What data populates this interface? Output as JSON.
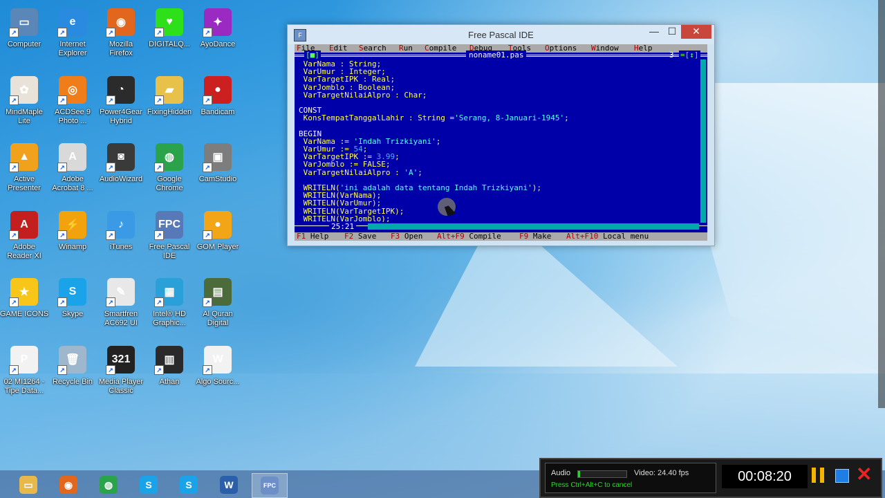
{
  "desktop_icons": [
    {
      "label": "Computer",
      "icon": "computer-icon",
      "color": "#5a86b8",
      "glyph": "▭"
    },
    {
      "label": "Internet\nExplorer",
      "icon": "ie-icon",
      "color": "#2a8ae0",
      "glyph": "e"
    },
    {
      "label": "Mozilla\nFirefox",
      "icon": "firefox-icon",
      "color": "#e2661c",
      "glyph": "◉"
    },
    {
      "label": "DIGITALQ...",
      "icon": "heart-icon",
      "color": "#2ee01a",
      "glyph": "♥"
    },
    {
      "label": "AyoDance",
      "icon": "ayodance-icon",
      "color": "#9b2ac2",
      "glyph": "✦"
    },
    {
      "label": "MindMaple\nLite",
      "icon": "mindmaple-icon",
      "color": "#e8e2d8",
      "glyph": "✿"
    },
    {
      "label": "ACDSee 9\nPhoto ...",
      "icon": "camera-icon",
      "color": "#ee7d1a",
      "glyph": "◎"
    },
    {
      "label": "Power4Gear\nHybrid",
      "icon": "gauge-icon",
      "color": "#2b2b2b",
      "glyph": "◔"
    },
    {
      "label": "FixingHidden",
      "icon": "folder-icon",
      "color": "#e8c14a",
      "glyph": "▰"
    },
    {
      "label": "Bandicam",
      "icon": "bandicam-icon",
      "color": "#cc1f1f",
      "glyph": "●"
    },
    {
      "label": "Active\nPresenter",
      "icon": "activepresenter-icon",
      "color": "#f0a21c",
      "glyph": "▲"
    },
    {
      "label": "Adobe\nAcrobat 8 ...",
      "icon": "acrobat-icon",
      "color": "#d9d9d9",
      "glyph": "A"
    },
    {
      "label": "AudioWizard",
      "icon": "speaker-icon",
      "color": "#3a3a3a",
      "glyph": "◙"
    },
    {
      "label": "Google\nChrome",
      "icon": "chrome-icon",
      "color": "#2aa34a",
      "glyph": "◍"
    },
    {
      "label": "CamStudio",
      "icon": "camstudio-icon",
      "color": "#7d7d7d",
      "glyph": "▣"
    },
    {
      "label": "Adobe\nReader XI",
      "icon": "adobe-reader-icon",
      "color": "#c41f1f",
      "glyph": "A"
    },
    {
      "label": "Winamp",
      "icon": "winamp-icon",
      "color": "#f2a20c",
      "glyph": "⚡"
    },
    {
      "label": "iTunes",
      "icon": "itunes-icon",
      "color": "#3a9ae6",
      "glyph": "♪"
    },
    {
      "label": "Free Pascal\nIDE",
      "icon": "freepascal-icon",
      "color": "#5779b8",
      "glyph": "FPC"
    },
    {
      "label": "GOM Player",
      "icon": "gomplayer-icon",
      "color": "#f2a516",
      "glyph": "●"
    },
    {
      "label": "GAME ICONS",
      "icon": "star-icon",
      "color": "#f7c618",
      "glyph": "★"
    },
    {
      "label": "Skype",
      "icon": "skype-icon",
      "color": "#1aa3e8",
      "glyph": "S"
    },
    {
      "label": "Smartfren\nAC692 UI",
      "icon": "smartfren-icon",
      "color": "#e8e8e8",
      "glyph": "✎"
    },
    {
      "label": "Intel® HD\nGraphic...",
      "icon": "intel-icon",
      "color": "#2aa0d8",
      "glyph": "▦"
    },
    {
      "label": "Al Quran\nDigital",
      "icon": "quran-icon",
      "color": "#4b6b3a",
      "glyph": "▤"
    },
    {
      "label": "02 MI1264 -\nTipe Data...",
      "icon": "powerpoint-file-icon",
      "color": "#f2f2f2",
      "glyph": "P"
    },
    {
      "label": "Recycle Bin",
      "icon": "recycle-bin-icon",
      "color": "#9fb7cc",
      "glyph": "🗑"
    },
    {
      "label": "Media Player\nClassic",
      "icon": "mediaplayer-icon",
      "color": "#222",
      "glyph": "321"
    },
    {
      "label": "Athan",
      "icon": "athan-icon",
      "color": "#2a2a2a",
      "glyph": "▥"
    },
    {
      "label": "Algo Sourc...",
      "icon": "word-file-icon",
      "color": "#f2f2f2",
      "glyph": "W"
    }
  ],
  "window": {
    "title": "Free Pascal IDE",
    "min_glyph": "—",
    "max_glyph": "☐",
    "close_glyph": "✕",
    "menu": [
      "File",
      "Edit",
      "Search",
      "Run",
      "Compile",
      "Debug",
      "Tools",
      "Options",
      "Window",
      "Help"
    ],
    "editor": {
      "filename": "noname01.pas",
      "window_number": "3",
      "close_btn": "[■]",
      "zoom_btn": "=[↕]",
      "cursor_position": "25:21",
      "code_lines": [
        " VarNama : String;",
        " VarUmur : Integer;",
        " VarTargetIPK : Real;",
        " VarJomblo : Boolean;",
        " VarTargetNilaiAlpro : Char;",
        "",
        "CONST",
        " KonsTempatTanggalLahir : String ='Serang, 8-Januari-1945';",
        "",
        "BEGIN",
        " VarNama := 'Indah Trizkiyani';",
        " VarUmur := 54;",
        " VarTargetIPK := 3.99;",
        " VarJomblo := FALSE;",
        " VarTargetNilaiAlpro : 'A';",
        "",
        " WRITELN('ini adalah data tentang Indah Trizkiyani');",
        " WRITELN(VarNama);",
        " WRITELN(VarUmur);",
        " WRITELN(VarTargetIPK);",
        " WRITELN(VarJomblo);"
      ]
    },
    "status_items": [
      {
        "key": "F1",
        "label": "Help"
      },
      {
        "key": "F2",
        "label": "Save"
      },
      {
        "key": "F3",
        "label": "Open"
      },
      {
        "key": "Alt+F9",
        "label": "Compile"
      },
      {
        "key": "F9",
        "label": "Make"
      },
      {
        "key": "Alt+F10",
        "label": "Local menu"
      }
    ]
  },
  "taskbar": {
    "items": [
      {
        "icon": "file-explorer-icon",
        "color": "#e8b84a",
        "glyph": "▭"
      },
      {
        "icon": "firefox-icon",
        "color": "#e2661c",
        "glyph": "◉"
      },
      {
        "icon": "chrome-icon",
        "color": "#2aa34a",
        "glyph": "◍"
      },
      {
        "icon": "skype-icon",
        "color": "#1aa3e8",
        "glyph": "S"
      },
      {
        "icon": "skype-alt-icon",
        "color": "#1aa3e8",
        "glyph": "S"
      },
      {
        "icon": "word-icon",
        "color": "#2b5faa",
        "glyph": "W"
      },
      {
        "icon": "freepascal-icon",
        "color": "#6d8fc8",
        "glyph": "FPC"
      }
    ]
  },
  "bandicam": {
    "audio_label": "Audio",
    "video_label": "Video: 24.40 fps",
    "hint": "Press Ctrl+Alt+C to cancel",
    "timer": "00:08:20"
  }
}
